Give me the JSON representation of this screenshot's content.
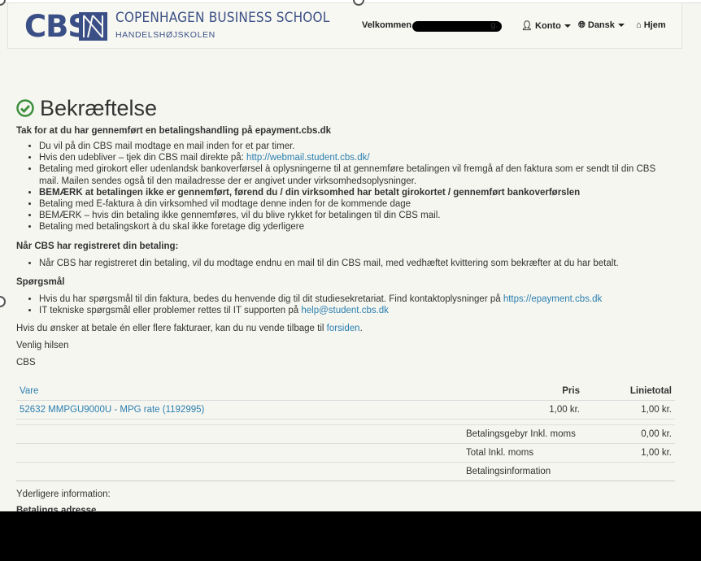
{
  "header": {
    "logo_text": "CBS",
    "school_name": "COPENHAGEN BUSINESS SCHOOL",
    "school_sub": "HANDELSHØJSKOLEN",
    "welcome_prefix": "Velkommen",
    "welcome_suffix": "g.",
    "account_label": "Konto",
    "language_label": "Dansk",
    "home_label": "Hjem"
  },
  "page": {
    "title": "Bekræftelse",
    "lead": "Tak for at du har gennemført en betalingshandling på epayment.cbs.dk",
    "bullets1": {
      "b1": "Du vil på din CBS mail modtage en mail inden for et par timer.",
      "b2_text": "Hvis den udebliver – tjek din CBS mail direkte på: ",
      "b2_link": "http://webmail.student.cbs.dk/",
      "b3": "Betaling med girokort eller udenlandsk bankoverførsel à oplysningerne til at gennemføre betalingen vil fremgå af den faktura som er sendt til din CBS mail. Mailen sendes også til den mailadresse der er angivet under virksomhedsoplysninger.",
      "b4": "BEMÆRK at betalingen ikke er gennemført, førend du / din virksomhed har betalt girokortet / gennemført bankoverførslen",
      "b5": "Betaling med E-faktura à din virksomhed vil modtage denne inden for de kommende dage",
      "b6": "BEMÆRK – hvis din betaling ikke gennemføres, vil du blive rykket for betalingen til din CBS mail.",
      "b7": "Betaling med betalingskort à du skal ikke foretage dig yderligere"
    },
    "section2_title": "Når CBS har registreret din betaling:",
    "section2_bullet": "Når CBS har registreret din betaling, vil du modtage endnu en mail til din CBS mail, med vedhæftet kvittering som bekræfter at du har betalt.",
    "section3_title": "Spørgsmål",
    "section3_b1_text": "Hvis du har spørgsmål til din faktura, bedes du henvende dig til dit studiesekretariat. Find kontaktoplysninger på ",
    "section3_b1_link": "https://epayment.cbs.dk",
    "section3_b2_text": "IT tekniske spørgsmål eller problemer rettes til IT supporten på ",
    "section3_b2_link": "help@student.cbs.dk",
    "return_text": "Hvis du ønsker at betale én eller flere fakturaer, kan du nu vende tilbage til ",
    "return_link": "forsiden",
    "return_end": ".",
    "closing": "Venlig hilsen",
    "signature": "CBS"
  },
  "table": {
    "col_item": "Vare",
    "col_price": "Pris",
    "col_total": "Linietotal",
    "item_name": "52632 MMPGU9000U - MPG rate (1192995)",
    "item_price": "1,00 kr.",
    "item_total": "1,00 kr.",
    "fee_label": "Betalingsgebyr Inkl. moms",
    "fee_value": "0,00 kr.",
    "total_label": "Total Inkl. moms",
    "total_value": "1,00 kr.",
    "payinfo_label": "Betalingsinformation"
  },
  "footer": {
    "more_info": "Yderligere information:",
    "address_title": "Betalings adresse"
  },
  "colors": {
    "brand": "#3a4f86",
    "link": "#2a7fb0",
    "success": "#3c8f3c"
  }
}
